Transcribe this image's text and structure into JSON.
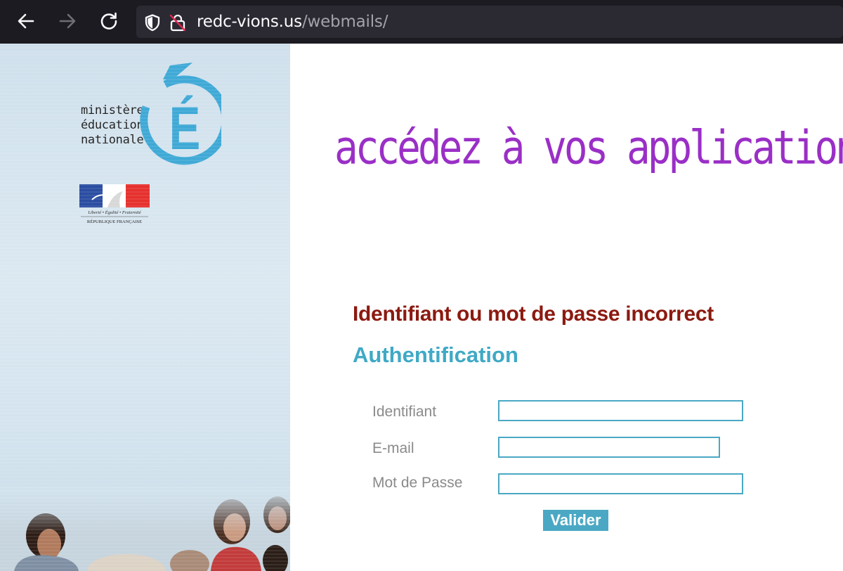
{
  "browser": {
    "url_host": "redc-vions.us",
    "url_path": "/webmails/",
    "icons": [
      "back-arrow-icon",
      "forward-arrow-icon",
      "reload-icon",
      "shield-icon",
      "insecure-lock-icon"
    ]
  },
  "sidebar": {
    "ministry_lines": [
      "ministère",
      "éducation",
      "nationale"
    ],
    "logo_letter": "É",
    "republic_motto": "Liberté • Égalité • Fraternité",
    "republic_name": "RÉPUBLIQUE FRANÇAISE"
  },
  "main": {
    "headline": "accédez à vos applications",
    "error_message": "Identifiant ou mot de passe incorrect",
    "auth_title": "Authentification",
    "form": {
      "identifiant_label": "Identifiant",
      "identifiant_value": "",
      "email_label": "E-mail",
      "email_value": "",
      "password_label": "Mot de Passe",
      "password_value": "",
      "submit_label": "Valider"
    }
  },
  "colors": {
    "headline": "#9a2fc6",
    "error": "#8b1a10",
    "accent": "#4aa8c4",
    "browser_bg": "#1c1b22"
  }
}
